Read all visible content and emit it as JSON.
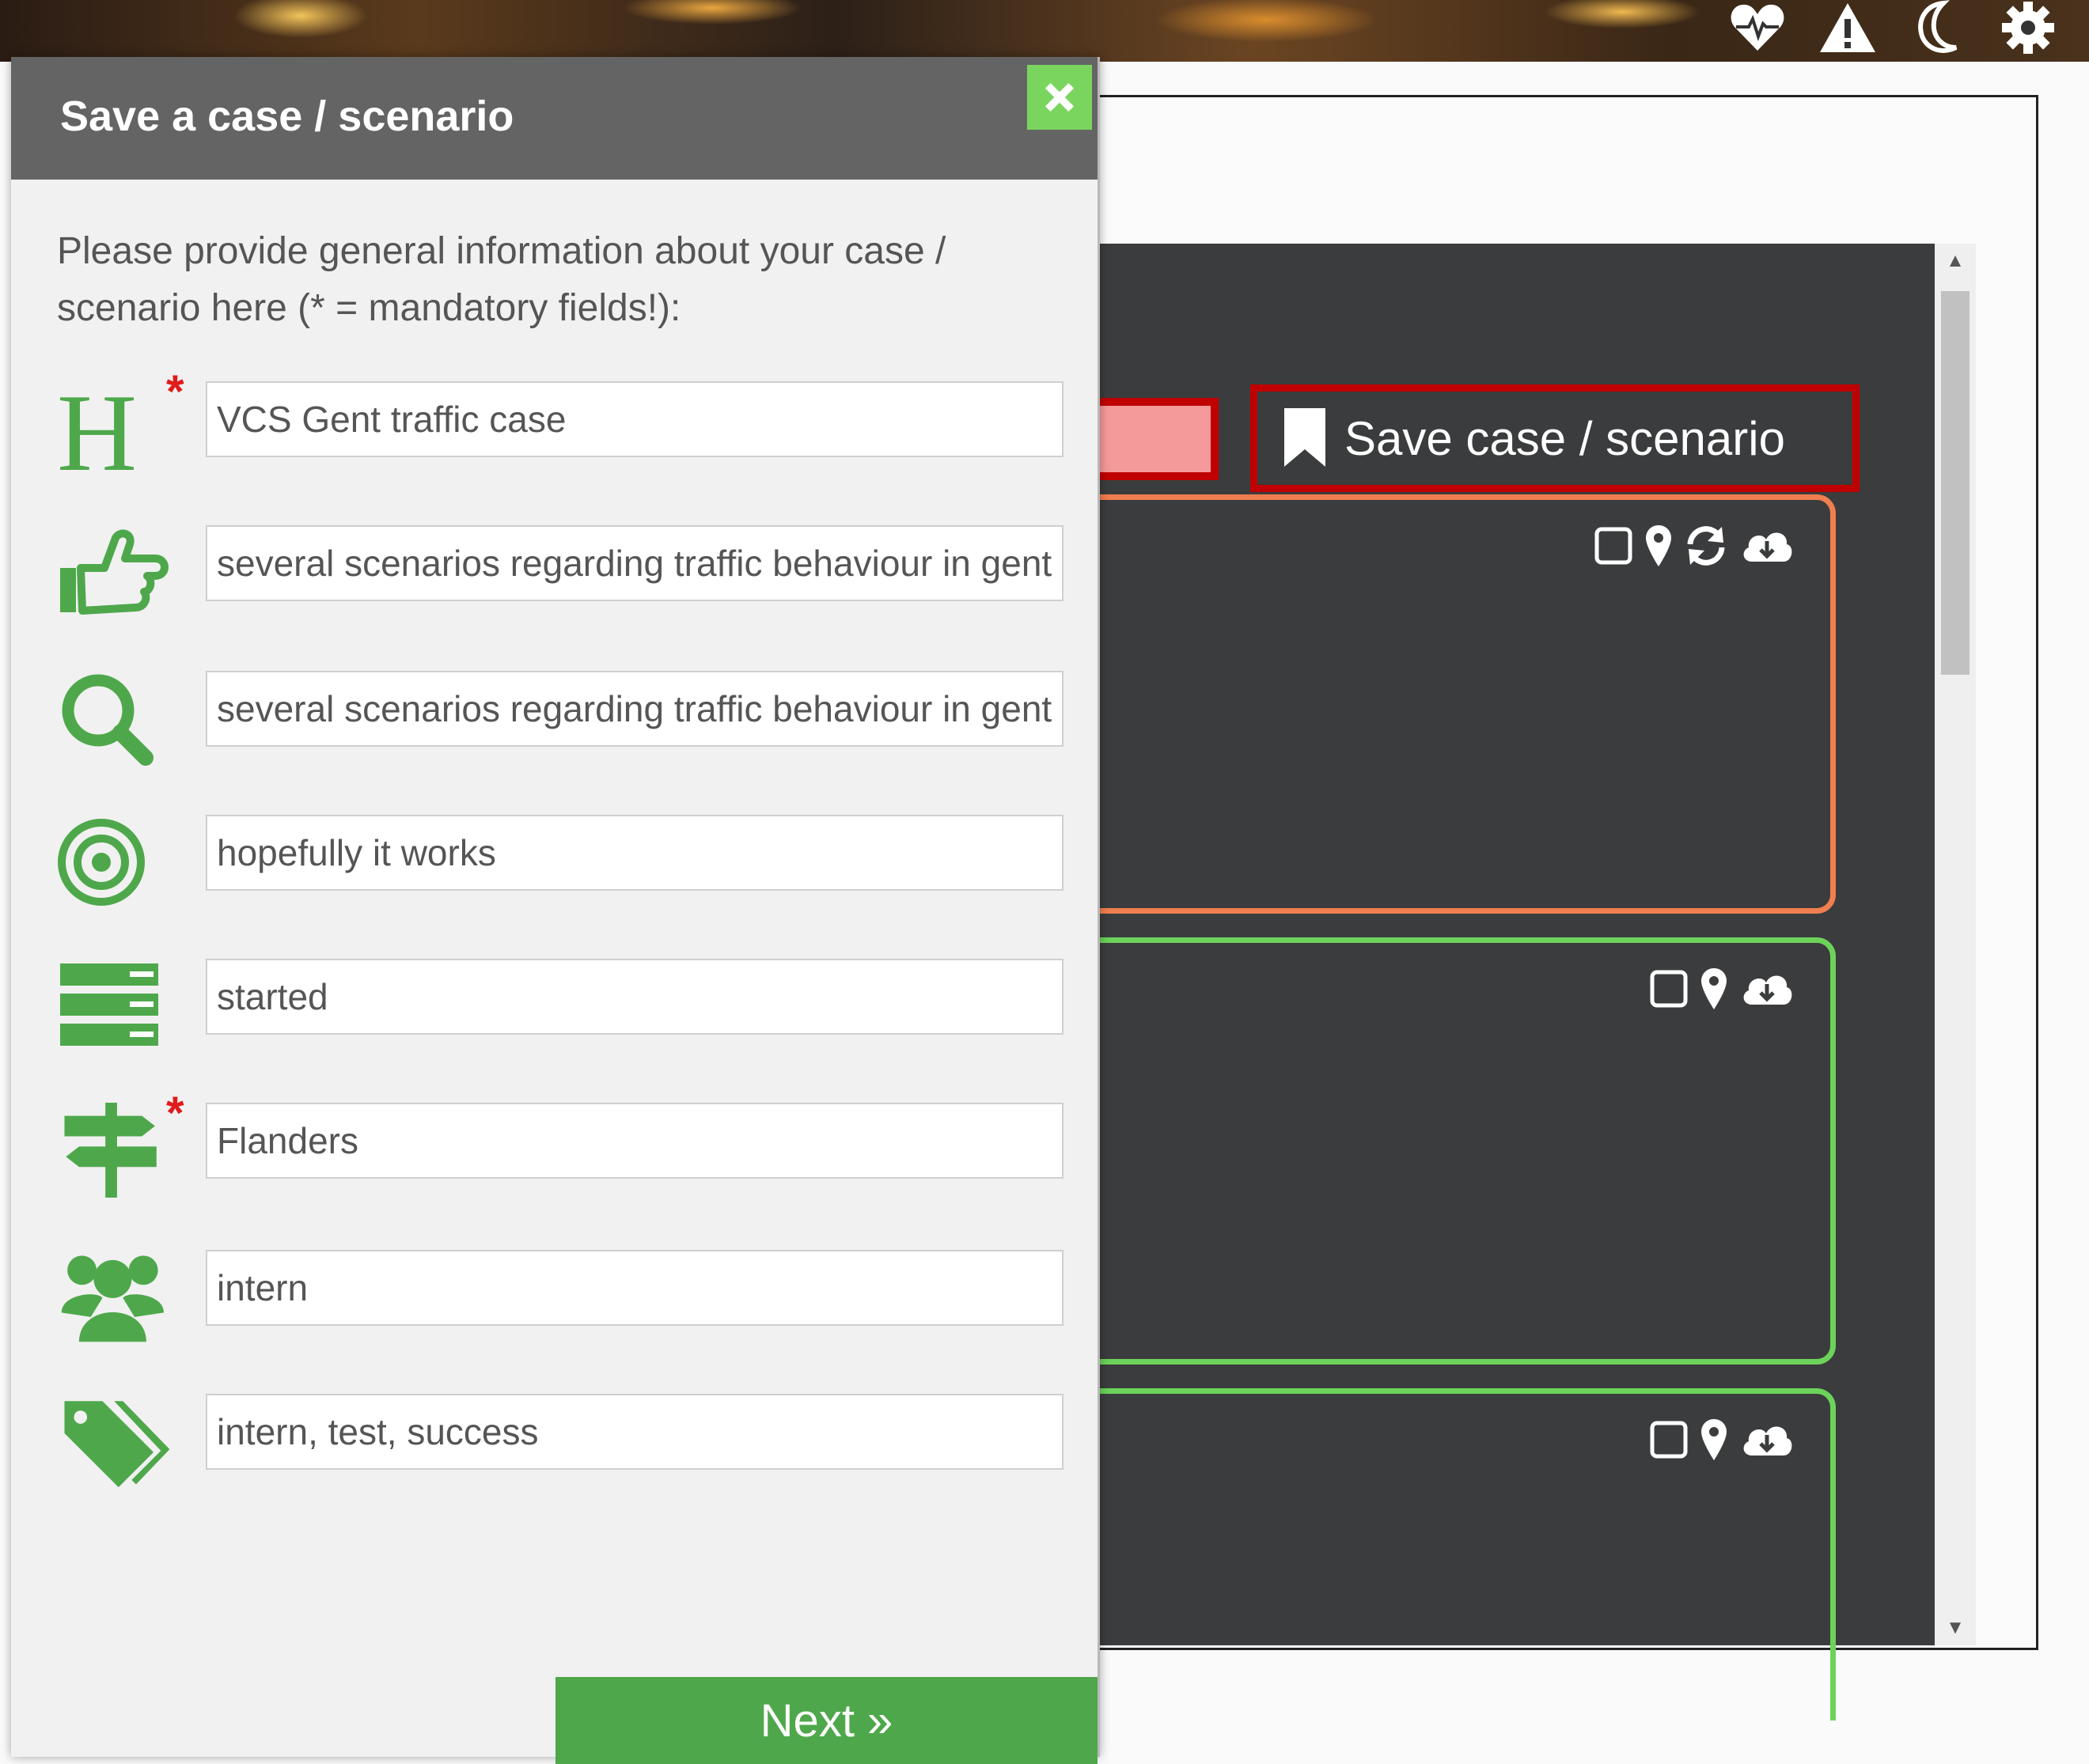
{
  "dialog": {
    "title": "Save a case / scenario",
    "intro": "Please provide general information about your case / scenario here (* = mandatory fields!):",
    "fields": [
      {
        "icon": "heading-icon",
        "required": true,
        "value": "VCS Gent traffic case"
      },
      {
        "icon": "thumbs-pointing-icon",
        "required": false,
        "value": "several scenarios regarding traffic behaviour in gent"
      },
      {
        "icon": "search-icon",
        "required": false,
        "value": "several scenarios regarding traffic behaviour in gent"
      },
      {
        "icon": "target-icon",
        "required": false,
        "value": "hopefully it works"
      },
      {
        "icon": "status-bars-icon",
        "required": false,
        "value": "started"
      },
      {
        "icon": "signpost-icon",
        "required": true,
        "value": "Flanders"
      },
      {
        "icon": "users-icon",
        "required": false,
        "value": "intern"
      },
      {
        "icon": "tags-icon",
        "required": false,
        "value": "intern, test, success"
      }
    ],
    "required_mark": "*",
    "next_label": "Next »"
  },
  "background": {
    "save_case_label": "Save case / scenario"
  },
  "colors": {
    "accent_green": "#4ea84b",
    "header_gray": "#646464",
    "highlight_red": "#c00000",
    "card_orange": "#f07f4f",
    "card_green": "#6cd35a"
  }
}
